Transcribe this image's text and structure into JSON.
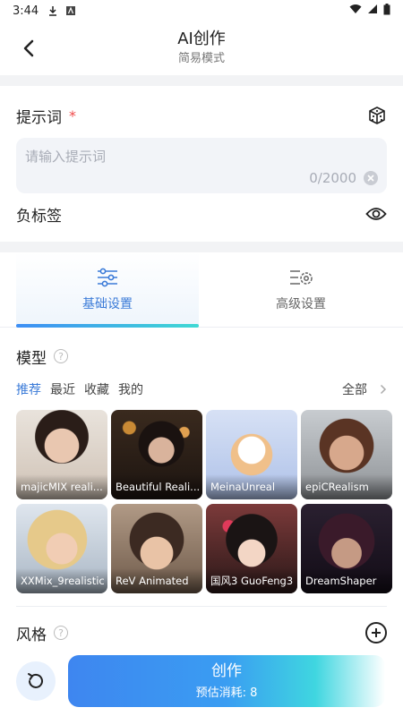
{
  "status": {
    "time": "3:44"
  },
  "header": {
    "title": "AI创作",
    "subtitle": "简易模式"
  },
  "prompt": {
    "label": "提示词",
    "required_mark": "*",
    "placeholder": "请输入提示词",
    "count": "0/2000"
  },
  "negative": {
    "label": "负标签"
  },
  "tabs": [
    {
      "label": "基础设置",
      "active": true
    },
    {
      "label": "高级设置",
      "active": false
    }
  ],
  "model": {
    "title": "模型",
    "help": "?",
    "filters": [
      "推荐",
      "最近",
      "收藏",
      "我的"
    ],
    "all_label": "全部",
    "cards": [
      {
        "name": "majicMIX reali..."
      },
      {
        "name": "Beautiful Reali..."
      },
      {
        "name": "MeinaUnreal"
      },
      {
        "name": "epiCRealism"
      },
      {
        "name": "XXMix_9realistic"
      },
      {
        "name": "ReV Animated"
      },
      {
        "name": "国风3 GuoFeng3"
      },
      {
        "name": "DreamShaper"
      }
    ]
  },
  "style": {
    "title": "风格",
    "help": "?"
  },
  "action": {
    "create_label": "创作",
    "cost_label": "预估消耗: 8"
  },
  "colors": {
    "accent": "#3b7bd8",
    "required": "#f04b4b"
  }
}
